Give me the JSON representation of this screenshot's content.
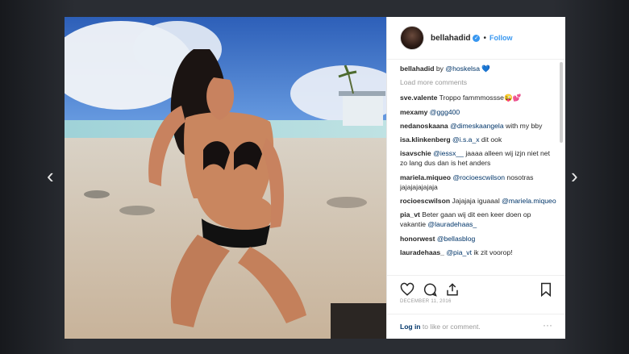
{
  "nav": {
    "prev": "‹",
    "next": "›"
  },
  "header": {
    "username": "bellahadid",
    "dot": "•",
    "follow": "Follow"
  },
  "caption": {
    "user": "bellahadid",
    "text": " by ",
    "mention": "@hoskelsa",
    "emoji": "💙"
  },
  "load_more": "Load more comments",
  "comments": [
    {
      "user": "sve.valente",
      "pre": " Troppo fammmossse😜💕",
      "mention": "",
      "post": ""
    },
    {
      "user": "mexamy",
      "pre": " ",
      "mention": "@ggg400",
      "post": ""
    },
    {
      "user": "nedanoskaana",
      "pre": " ",
      "mention": "@dimeskaangela",
      "post": " with my bby"
    },
    {
      "user": "isa.klinkenberg",
      "pre": " ",
      "mention": "@i.s.a_x",
      "post": " dit ook"
    },
    {
      "user": "isavschie",
      "pre": " ",
      "mention": "@iessx__",
      "post": " jaaaa alleen wij izjn niet net zo lang dus dan is het anders"
    },
    {
      "user": "mariela.miqueo",
      "pre": " ",
      "mention": "@rocioescwilson",
      "post": " nosotras jajajajajajaja"
    },
    {
      "user": "rocioescwilson",
      "pre": " Jajajaja iguaaal ",
      "mention": "@mariela.miqueo",
      "post": ""
    },
    {
      "user": "pia_vt",
      "pre": " Beter gaan wij dit een keer doen op vakantie ",
      "mention": "@lauradehaas_",
      "post": ""
    },
    {
      "user": "honorwest",
      "pre": " ",
      "mention": "@bellasblog",
      "post": ""
    },
    {
      "user": "lauradehaas_",
      "pre": " ",
      "mention": "@pia_vt",
      "post": " ik zit voorop!"
    }
  ],
  "date": "DECEMBER 11, 2016",
  "login": {
    "link": "Log in",
    "text": " to like or comment.",
    "more": "···"
  },
  "icons": [
    "heart-icon",
    "comment-icon",
    "share-icon",
    "bookmark-icon",
    "verified-icon",
    "chevron-left-icon",
    "chevron-right-icon"
  ]
}
